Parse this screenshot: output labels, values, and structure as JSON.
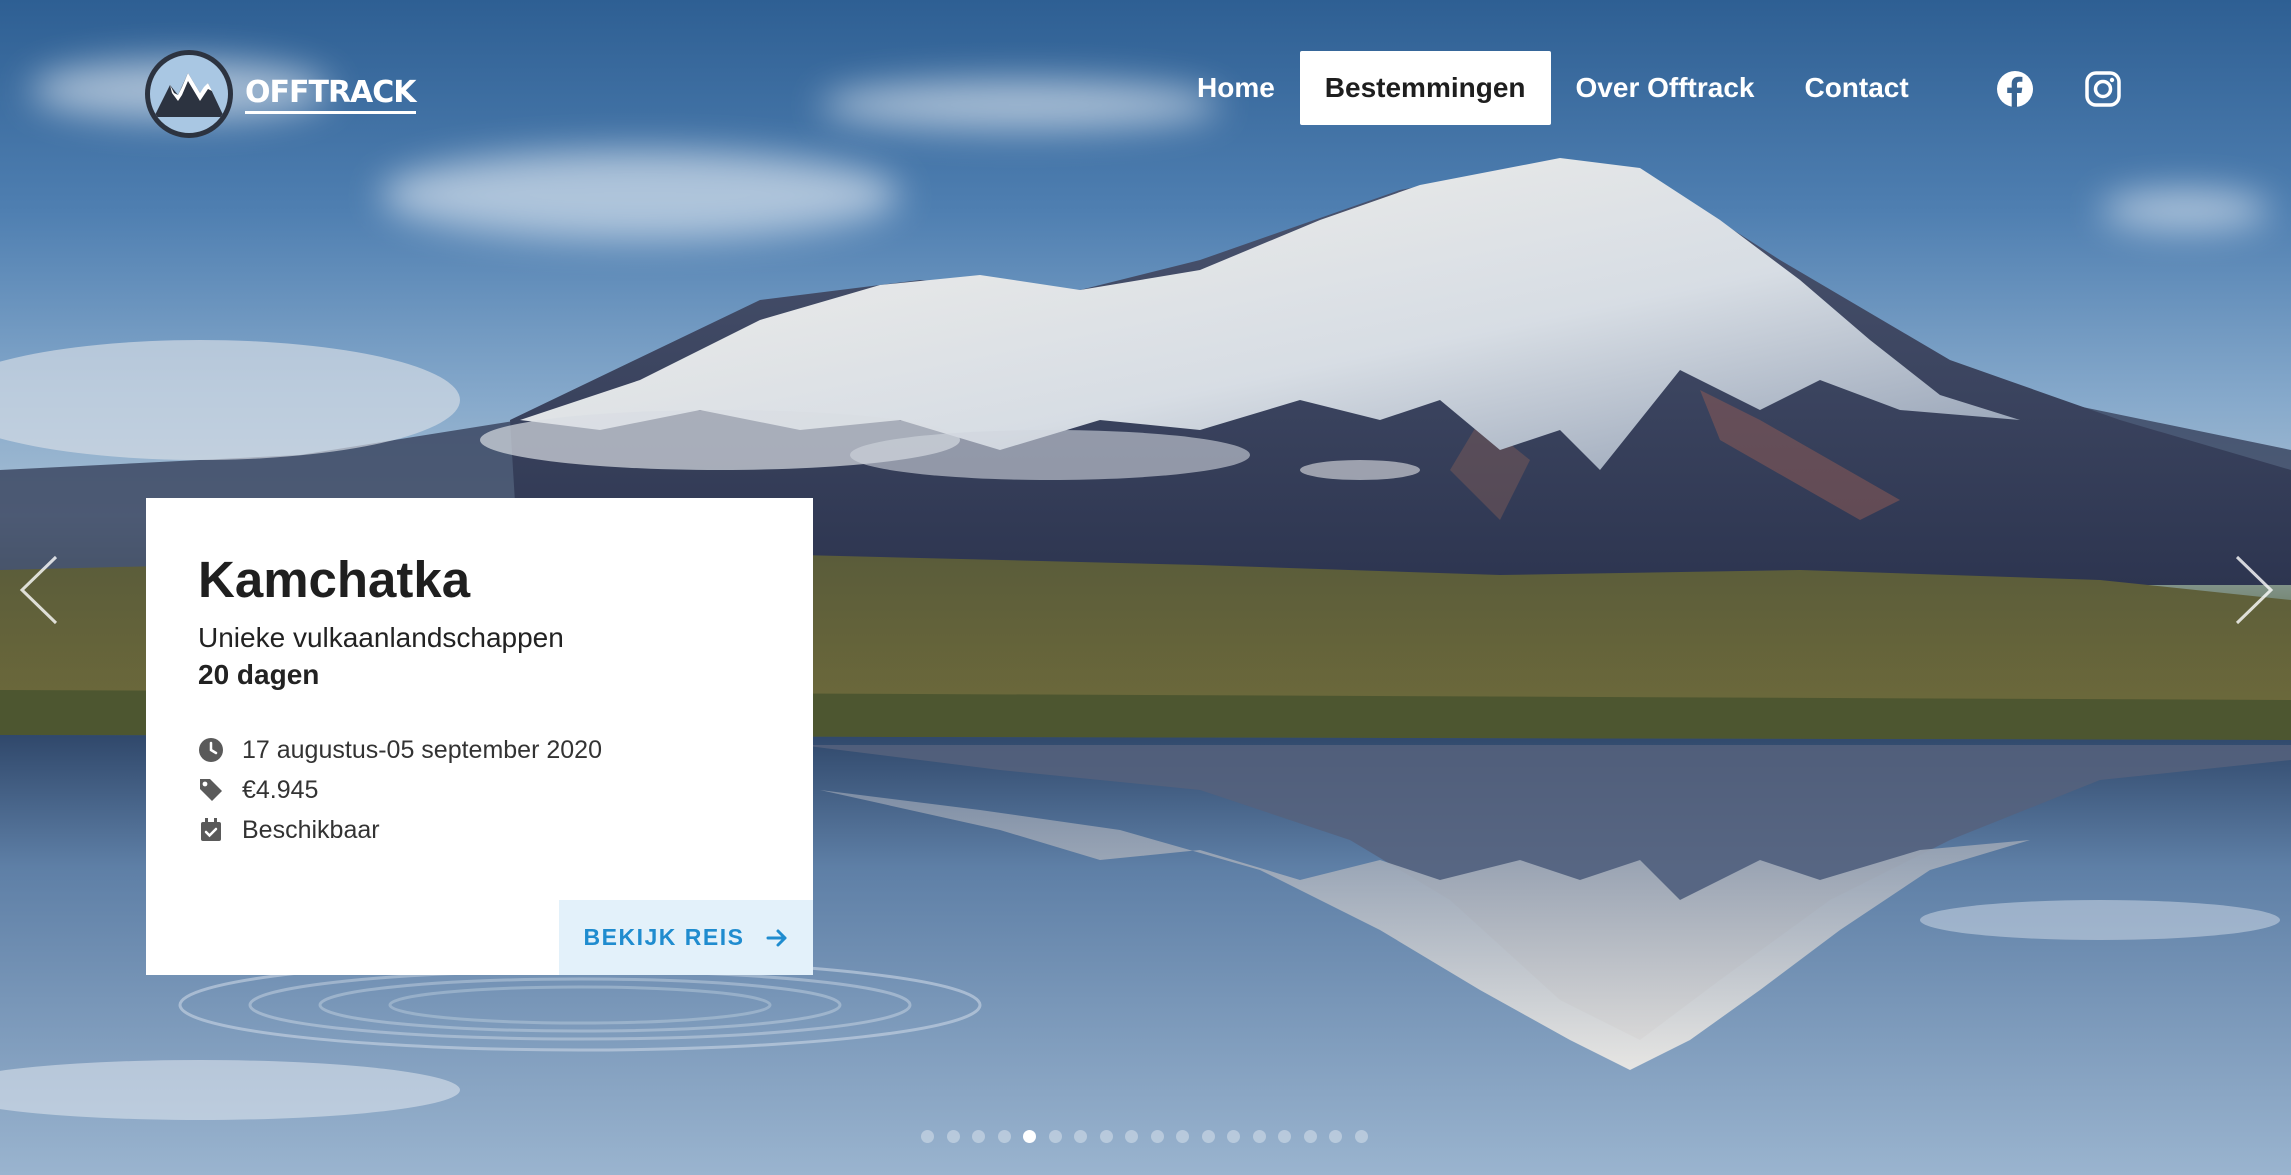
{
  "brand": {
    "logo_text": "OFFTRACK"
  },
  "nav": {
    "items": [
      {
        "label": "Home"
      },
      {
        "label": "Bestemmingen"
      },
      {
        "label": "Over Offtrack"
      },
      {
        "label": "Contact"
      }
    ],
    "active": "Bestemmingen",
    "social": [
      "facebook-icon",
      "instagram-icon"
    ]
  },
  "slide": {
    "title": "Kamchatka",
    "subtitle": "Unieke vulkaanlandschappen",
    "duration": "20 dagen",
    "dates": "17 augustus-05 september 2020",
    "price": "€4.945",
    "availability": "Beschikbaar",
    "cta_label": "BEKIJK REIS"
  },
  "carousel": {
    "total_slides": 18,
    "active_index": 4
  },
  "colors": {
    "accent": "#1f8ccf",
    "cta_bg": "#e3f1fa",
    "card_bg": "#ffffff",
    "title": "#1f1f1f"
  }
}
